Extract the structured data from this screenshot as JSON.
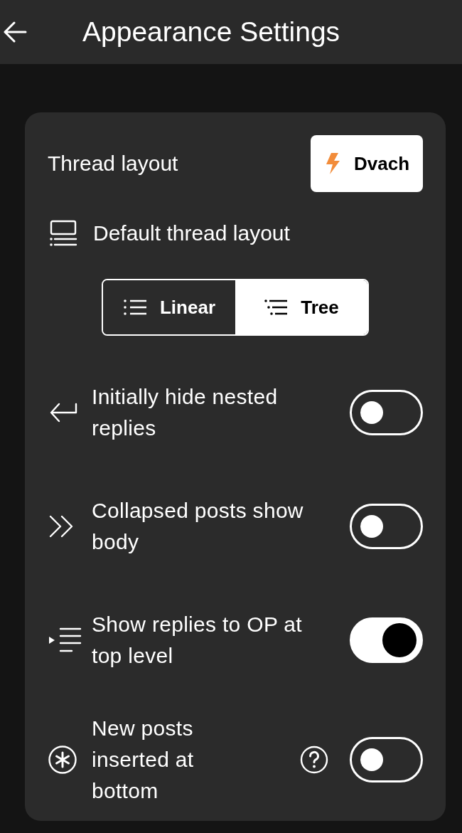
{
  "header": {
    "title": "Appearance Settings"
  },
  "section": {
    "title": "Thread layout",
    "imageboard_button": {
      "label": "Dvach"
    },
    "default_layout": {
      "label": "Default thread layout",
      "options": [
        {
          "label": "Linear",
          "selected": false
        },
        {
          "label": "Tree",
          "selected": true
        }
      ]
    },
    "settings": [
      {
        "kind": "toggle",
        "label": "Initially hide nested replies",
        "on": false,
        "help": false
      },
      {
        "kind": "toggle",
        "label": "Collapsed posts show body",
        "on": false,
        "help": false
      },
      {
        "kind": "toggle",
        "label": "Show replies to OP at top level",
        "on": true,
        "help": false
      },
      {
        "kind": "toggle",
        "label": "New posts inserted at bottom",
        "on": false,
        "help": true
      }
    ]
  }
}
